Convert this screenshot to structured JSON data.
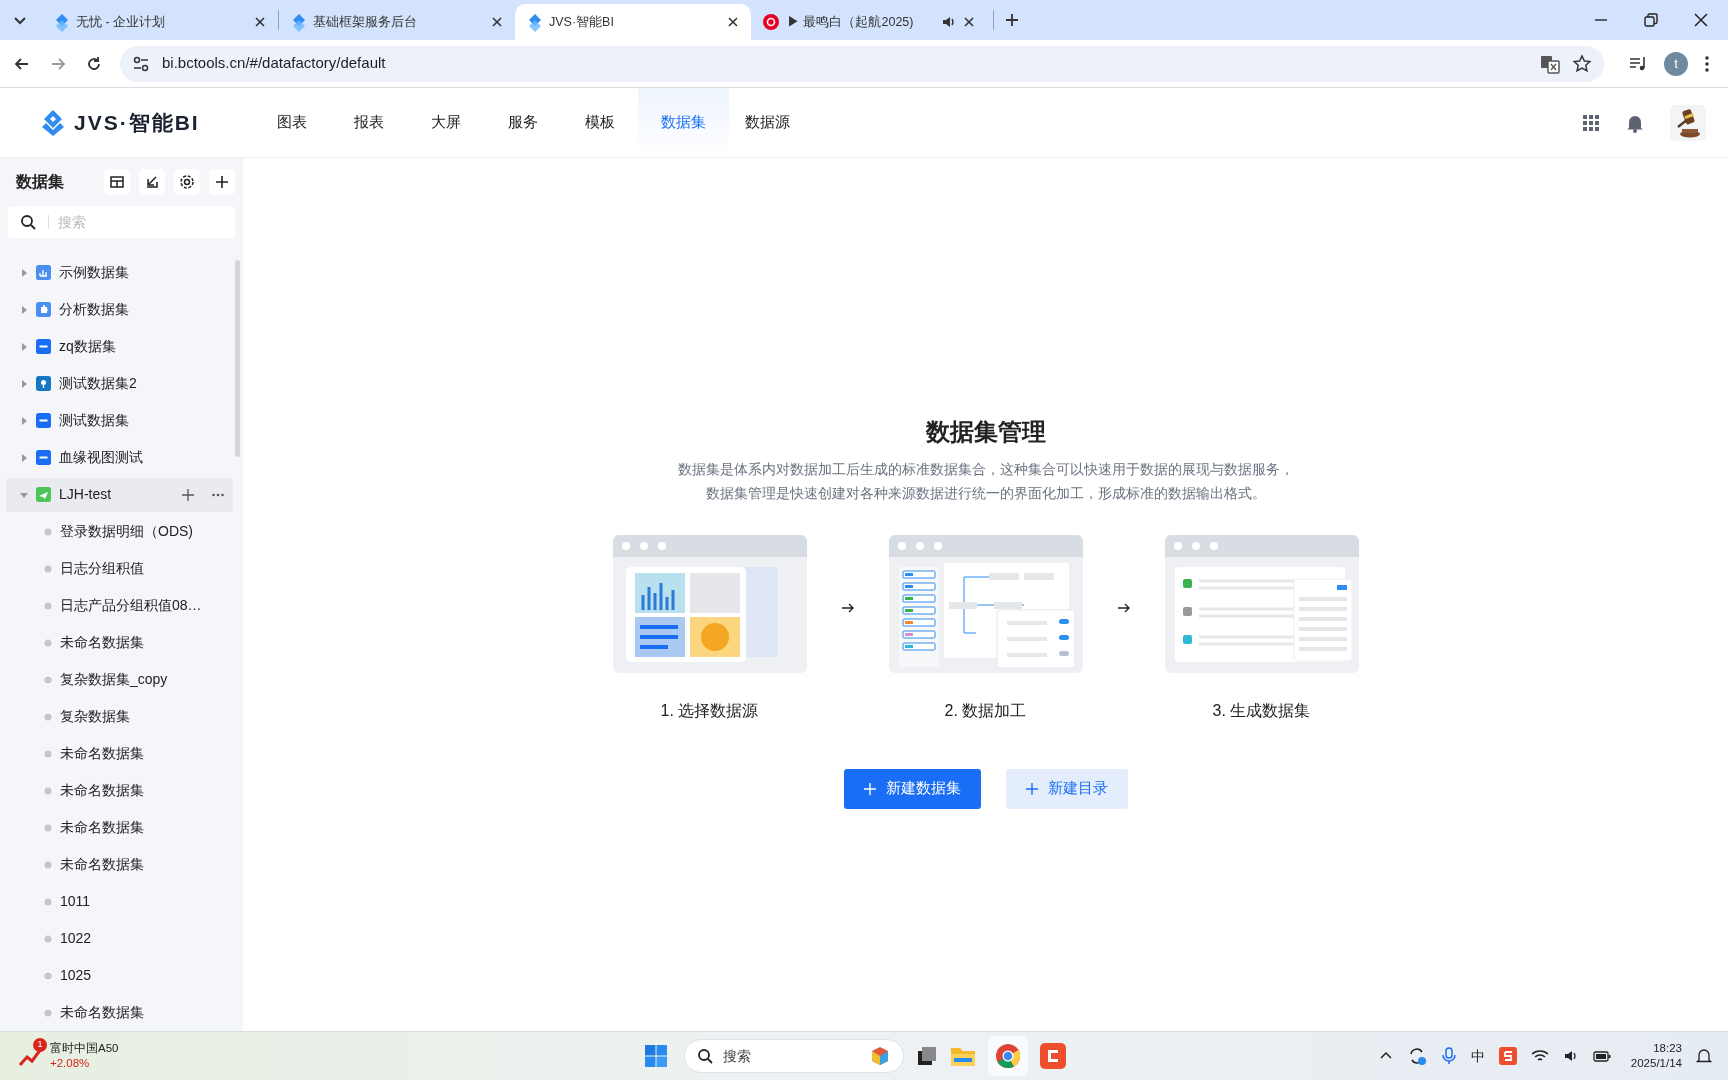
{
  "browser": {
    "tabs": [
      {
        "title": "无忧 - 企业计划",
        "selected": false,
        "audio": false
      },
      {
        "title": "基础框架服务后台",
        "selected": false,
        "audio": false
      },
      {
        "title": "JVS·智能BI",
        "selected": true,
        "audio": false
      },
      {
        "title": "▶ 最鸣白（起航2025)",
        "selected": false,
        "audio": true
      }
    ],
    "address": "bi.bctools.cn/#/datafactory/default",
    "profile": "t"
  },
  "header": {
    "logo": "JVS·智能BI",
    "nav": [
      {
        "label": "图表",
        "selected": false
      },
      {
        "label": "报表",
        "selected": false
      },
      {
        "label": "大屏",
        "selected": false
      },
      {
        "label": "服务",
        "selected": false
      },
      {
        "label": "模板",
        "selected": false
      },
      {
        "label": "数据集",
        "selected": true
      },
      {
        "label": "数据源",
        "selected": false
      }
    ]
  },
  "sidebar": {
    "title": "数据集",
    "search": {
      "placeholder": "搜索"
    },
    "tree": [
      {
        "label": "示例数据集",
        "color": "#4a8ef0",
        "expanded": false,
        "hovered": false
      },
      {
        "label": "分析数据集",
        "color": "#4a8ef0",
        "expanded": false,
        "hovered": false
      },
      {
        "label": "zq数据集",
        "color": "#1a6ef5",
        "expanded": false,
        "hovered": false
      },
      {
        "label": "测试数据集2",
        "color": "#1677c2",
        "expanded": false,
        "hovered": false
      },
      {
        "label": "测试数据集",
        "color": "#1a6ef5",
        "expanded": false,
        "hovered": false
      },
      {
        "label": "血缘视图测试",
        "color": "#1a6ef5",
        "expanded": false,
        "hovered": false
      },
      {
        "label": "LJH-test",
        "color": "#4cc45a",
        "expanded": true,
        "hovered": true,
        "children": [
          {
            "label": "登录数据明细（ODS)"
          },
          {
            "label": "日志分组积值"
          },
          {
            "label": "日志产品分组积值08…"
          },
          {
            "label": "未命名数据集"
          },
          {
            "label": "复杂数据集_copy"
          },
          {
            "label": "复杂数据集"
          },
          {
            "label": "未命名数据集"
          },
          {
            "label": "未命名数据集"
          },
          {
            "label": "未命名数据集"
          },
          {
            "label": "未命名数据集"
          },
          {
            "label": "1011"
          },
          {
            "label": "1022"
          },
          {
            "label": "1025"
          },
          {
            "label": "未命名数据集"
          }
        ]
      }
    ]
  },
  "main": {
    "title": "数据集管理",
    "description": [
      "数据集是体系内对数据加工后生成的标准数据集合，这种集合可以快速用于数据的展现与数据服务，",
      "数据集管理是快速创建对各种来源数据进行统一的界面化加工，形成标准的数据输出格式。"
    ],
    "steps": [
      {
        "label": "1. 选择数据源"
      },
      {
        "label": "2. 数据加工"
      },
      {
        "label": "3. 生成数据集"
      }
    ],
    "buttons": [
      {
        "label": "新建数据集",
        "kind": "primary"
      },
      {
        "label": "新建目录",
        "kind": "secondary"
      }
    ]
  },
  "taskbar": {
    "stock": {
      "name": "富时中国A50",
      "change": "+2.08%",
      "badge": "1"
    },
    "search": "搜索",
    "ime": "中",
    "time": "18:23",
    "date": "2025/1/14"
  }
}
